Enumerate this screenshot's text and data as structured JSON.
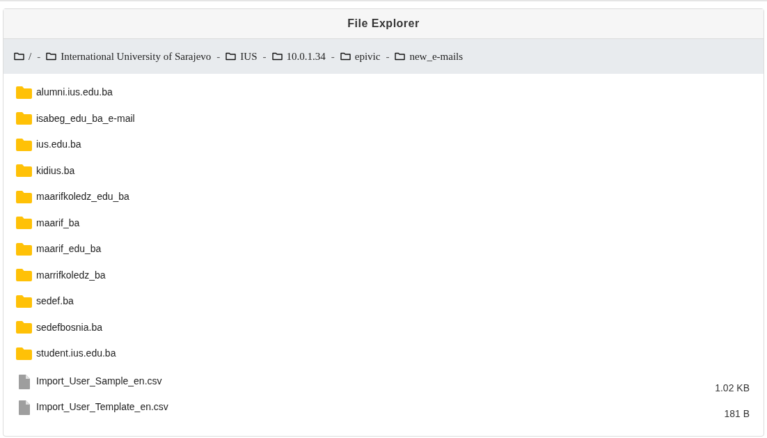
{
  "window": {
    "title": "File Explorer"
  },
  "breadcrumb": {
    "separator": "-",
    "items": [
      {
        "label": "/"
      },
      {
        "label": "International University of Sarajevo"
      },
      {
        "label": "IUS"
      },
      {
        "label": "10.0.1.34"
      },
      {
        "label": "epivic"
      },
      {
        "label": "new_e-mails"
      }
    ]
  },
  "entries": [
    {
      "kind": "folder",
      "name": "alumni.ius.edu.ba"
    },
    {
      "kind": "folder",
      "name": "isabeg_edu_ba_e-mail"
    },
    {
      "kind": "folder",
      "name": "ius.edu.ba"
    },
    {
      "kind": "folder",
      "name": "kidius.ba"
    },
    {
      "kind": "folder",
      "name": "maarifkoledz_edu_ba"
    },
    {
      "kind": "folder",
      "name": "maarif_ba"
    },
    {
      "kind": "folder",
      "name": "maarif_edu_ba"
    },
    {
      "kind": "folder",
      "name": "marrifkoledz_ba"
    },
    {
      "kind": "folder",
      "name": "sedef.ba"
    },
    {
      "kind": "folder",
      "name": "sedefbosnia.ba"
    },
    {
      "kind": "folder",
      "name": "student.ius.edu.ba"
    },
    {
      "kind": "file",
      "name": "Import_User_Sample_en.csv",
      "size": "1.02 KB"
    },
    {
      "kind": "file",
      "name": "Import_User_Template_en.csv",
      "size": "181 B"
    }
  ]
}
